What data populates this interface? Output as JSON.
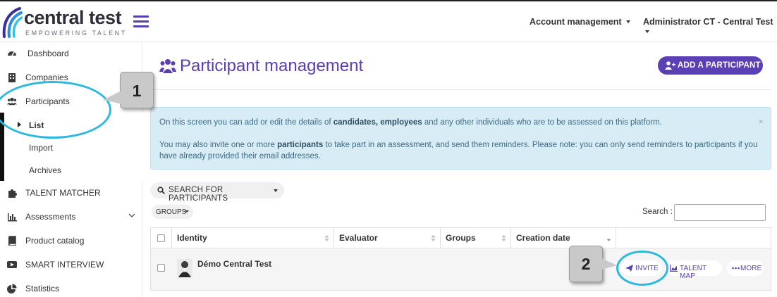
{
  "header": {
    "logo_title": "central test",
    "logo_subtitle": "EMPOWERING TALENT",
    "account_management": "Account management",
    "user_menu": "Administrator CT - Central Test"
  },
  "sidebar": {
    "items": [
      {
        "label": "Dashboard",
        "icon": "dashboard-icon"
      },
      {
        "label": "Companies",
        "icon": "building-icon"
      },
      {
        "label": "Participants",
        "icon": "users-icon"
      },
      {
        "label": "TALENT MATCHER",
        "icon": "puzzle-icon"
      },
      {
        "label": "Assessments",
        "icon": "bar-chart-icon"
      },
      {
        "label": "Product catalog",
        "icon": "book-icon"
      },
      {
        "label": "SMART INTERVIEW",
        "icon": "video-icon"
      },
      {
        "label": "Statistics",
        "icon": "pie-chart-icon"
      }
    ],
    "participants_sub": [
      {
        "label": "List",
        "active": true
      },
      {
        "label": "Import",
        "active": false
      },
      {
        "label": "Archives",
        "active": false
      }
    ]
  },
  "main": {
    "title": "Participant management",
    "add_button": "ADD A PARTICIPANT",
    "info": {
      "p1_a": "On this screen you can add or edit the details of ",
      "p1_b": "candidates, employees",
      "p1_c": " and any other individuals who are to be assessed on this platform.",
      "p2_a": "You may also invite one or more ",
      "p2_b": "participants",
      "p2_c": " to take part in an assessment, and send them reminders. Please note: you can only send reminders to participants if you have already provided their email addresses.",
      "close": "×"
    },
    "search_participants": "SEARCH FOR PARTICIPANTS",
    "groups_button": "GROUPS",
    "search_label": "Search :",
    "search_value": "",
    "table": {
      "columns": [
        "Identity",
        "Evaluator",
        "Groups",
        "Creation date"
      ],
      "rows": [
        {
          "identity": "Démo Central Test",
          "evaluator": "",
          "groups": "",
          "creation_date": ""
        }
      ],
      "actions": {
        "invite": "INVITE",
        "talent_map": "TALENT MAP",
        "more": "MORE"
      }
    }
  },
  "annotations": {
    "callout_1": "1",
    "callout_2": "2"
  },
  "colors": {
    "accent": "#5b3fb5",
    "info_bg": "#d8ecf6",
    "highlight_ring": "#2cb8df"
  }
}
